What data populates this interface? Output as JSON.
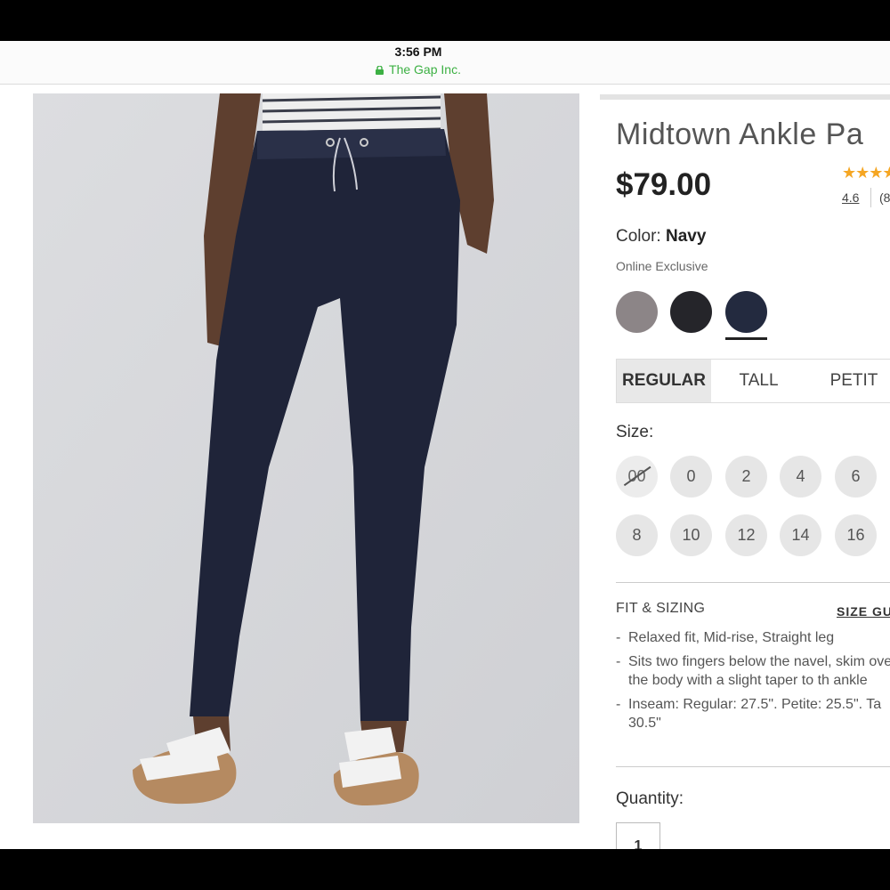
{
  "status": {
    "time": "3:56 PM",
    "site": "The Gap Inc."
  },
  "product": {
    "title": "Midtown Ankle Pa",
    "price": "$79.00",
    "stars": "★★★★",
    "rating": "4.6",
    "reviews": "(8",
    "color_label": "Color:",
    "color_value": "Navy",
    "badge": "Online Exclusive",
    "swatches": [
      {
        "name": "Gray",
        "hex": "#8c8587"
      },
      {
        "name": "Black",
        "hex": "#25252a"
      },
      {
        "name": "Navy",
        "hex": "#232a3f",
        "selected": true
      }
    ]
  },
  "fit_tabs": [
    "REGULAR",
    "TALL",
    "PETIT"
  ],
  "size": {
    "label": "Size:",
    "options": [
      "00",
      "0",
      "2",
      "4",
      "6",
      "8",
      "10",
      "12",
      "14",
      "16"
    ],
    "unavailable": [
      "00"
    ]
  },
  "fit_sizing": {
    "heading": "FIT & SIZING",
    "guide_link": "SIZE GU",
    "bullets": [
      "Relaxed fit, Mid-rise, Straight leg",
      "Sits two fingers below the navel, skim over the body with a slight taper to th ankle",
      "Inseam: Regular: 27.5\". Petite: 25.5\". Ta 30.5\""
    ]
  },
  "quantity": {
    "label": "Quantity:",
    "value": "1"
  },
  "colors": {
    "secure": "#3cb043",
    "star": "#f5a623",
    "navy_pants": "#1f2439"
  }
}
